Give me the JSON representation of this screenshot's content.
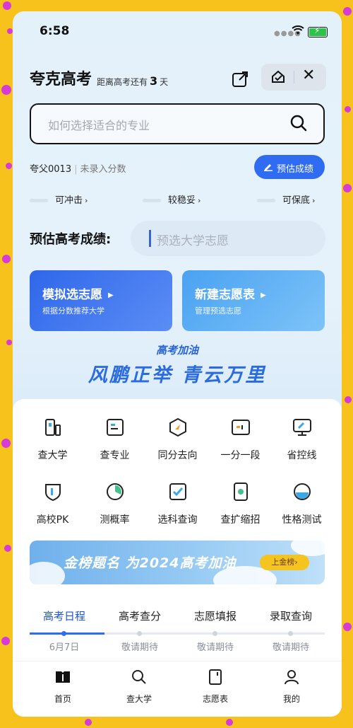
{
  "status_bar": {
    "time": "6:58"
  },
  "header": {
    "app_title": "夸克高考",
    "countdown_prefix": "距离高考还有",
    "countdown_days": "3",
    "countdown_suffix": "天"
  },
  "search": {
    "placeholder": "如何选择适合的专业"
  },
  "user": {
    "name": "夸父0013",
    "score_status": "未录入分数",
    "estimate_button": "预估成绩"
  },
  "levels": [
    {
      "label": "可冲击"
    },
    {
      "label": "较稳妥"
    },
    {
      "label": "可保底"
    }
  ],
  "prediction": {
    "label": "预估高考成绩:",
    "placeholder": "预选大学志愿"
  },
  "cards": [
    {
      "title": "模拟选志愿",
      "subtitle": "根据分数推荐大学"
    },
    {
      "title": "新建志愿表",
      "subtitle": "管理预选志愿"
    }
  ],
  "banner_top": {
    "small": "高考加油",
    "big": "风鹏正举  青云万里"
  },
  "tools": [
    {
      "label": "查大学",
      "icon": "university-icon"
    },
    {
      "label": "查专业",
      "icon": "major-book-icon"
    },
    {
      "label": "同分去向",
      "icon": "same-score-icon"
    },
    {
      "label": "一分一段",
      "icon": "score-segment-icon"
    },
    {
      "label": "省控线",
      "icon": "province-line-icon"
    },
    {
      "label": "高校PK",
      "icon": "pk-shield-icon"
    },
    {
      "label": "测概率",
      "icon": "probability-pie-icon"
    },
    {
      "label": "选科查询",
      "icon": "subject-check-icon"
    },
    {
      "label": "查扩缩招",
      "icon": "enrollment-icon"
    },
    {
      "label": "性格测试",
      "icon": "personality-icon"
    }
  ],
  "banner_bottom": {
    "text": "金榜题名 为2024高考加油",
    "button": "上金榜›"
  },
  "schedule_tabs": [
    {
      "label": "高考日程",
      "date": "6月7日",
      "active": true
    },
    {
      "label": "高考查分",
      "date": "敬请期待",
      "active": false
    },
    {
      "label": "志愿填报",
      "date": "敬请期待",
      "active": false
    },
    {
      "label": "录取查询",
      "date": "敬请期待",
      "active": false
    }
  ],
  "bottom_nav": [
    {
      "label": "首页",
      "icon": "home-book-icon"
    },
    {
      "label": "查大学",
      "icon": "search-icon"
    },
    {
      "label": "志愿表",
      "icon": "form-icon"
    },
    {
      "label": "我的",
      "icon": "profile-icon"
    }
  ],
  "colors": {
    "accent": "#2f6cf2",
    "background": "#f7c21c"
  }
}
